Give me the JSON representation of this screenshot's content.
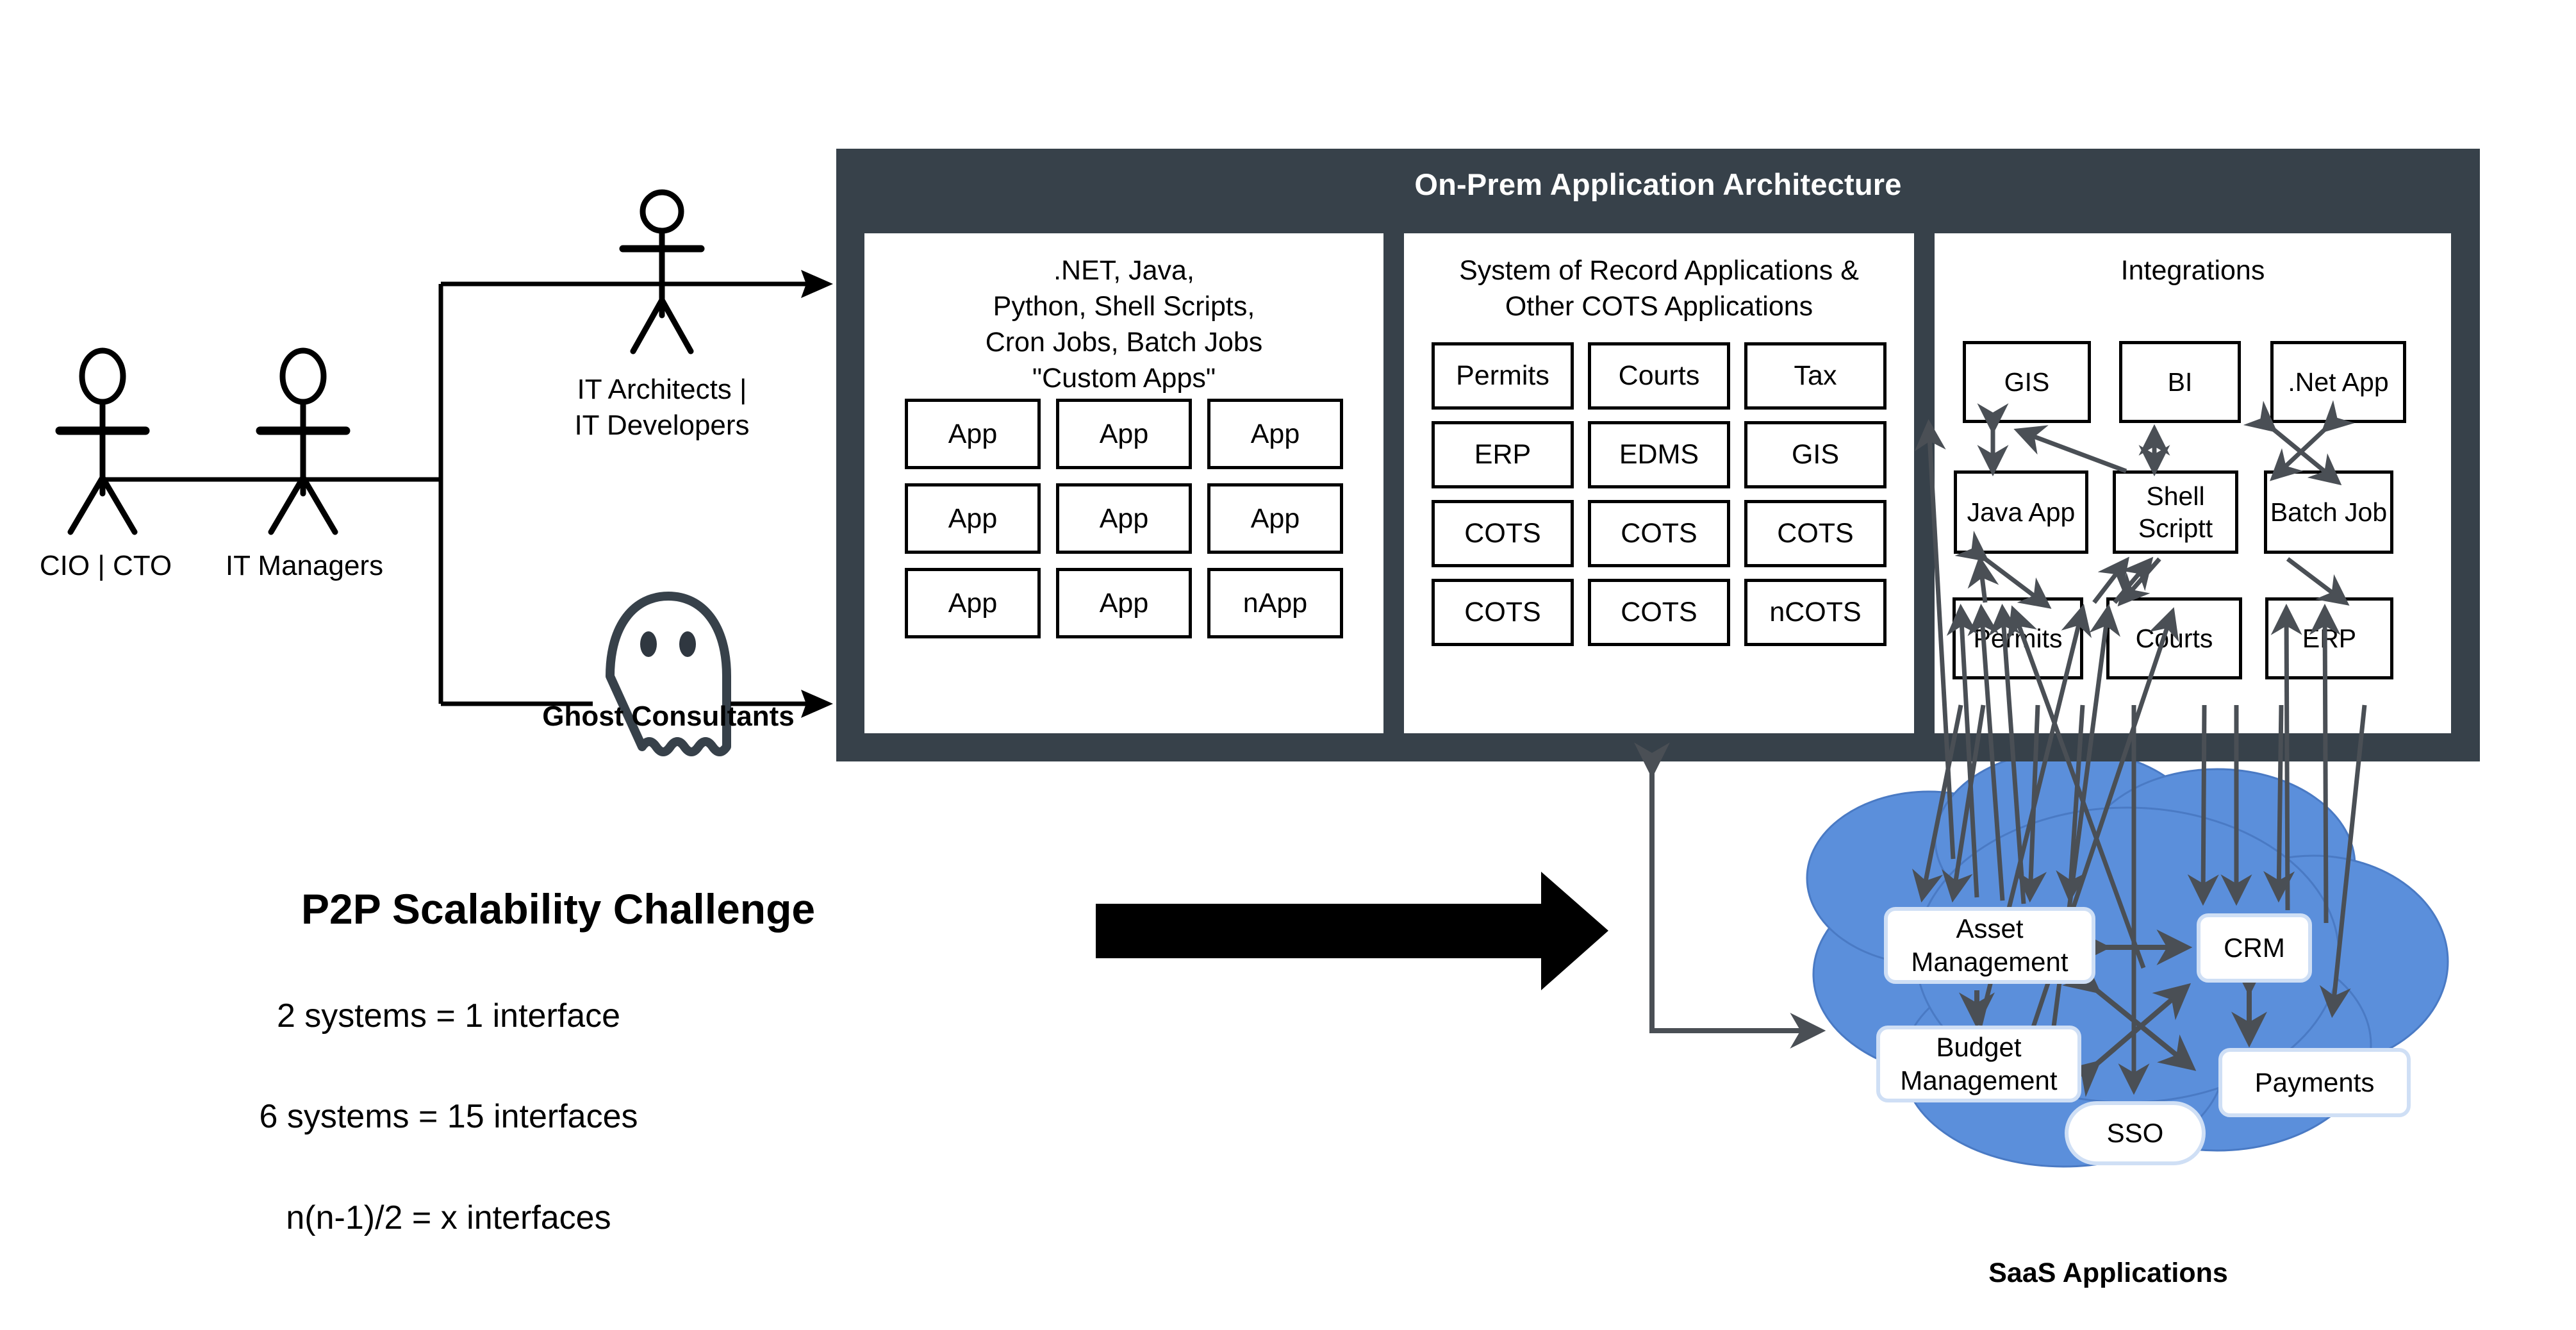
{
  "onprem": {
    "title": "On-Prem Application Architecture",
    "panels": [
      {
        "id": "custom-apps",
        "heading": ".NET, Java,\nPython, Shell Scripts,\nCron Jobs, Batch Jobs\n\"Custom Apps\"",
        "cells": [
          "App",
          "App",
          "App",
          "App",
          "App",
          "App",
          "App",
          "App",
          "nApp"
        ]
      },
      {
        "id": "system-of-record",
        "heading": "System of Record Applications &\nOther COTS Applications",
        "cells": [
          "Permits",
          "Courts",
          "Tax",
          "ERP",
          "EDMS",
          "GIS",
          "COTS",
          "COTS",
          "COTS",
          "COTS",
          "COTS",
          "nCOTS"
        ]
      },
      {
        "id": "integrations",
        "heading": "Integrations",
        "cells": [
          "GIS",
          "BI",
          ".Net App",
          "Java App",
          "Shell\nScriptt",
          "Batch\nJob",
          "Permits",
          "Courts",
          "ERP"
        ]
      }
    ]
  },
  "people": [
    {
      "id": "cio-cto",
      "label": "CIO | CTO",
      "bold": false
    },
    {
      "id": "it-managers",
      "label": "IT Managers",
      "bold": false
    },
    {
      "id": "it-architects",
      "label": "IT Architects |\nIT Developers",
      "bold": false
    },
    {
      "id": "ghost-consultants",
      "label": "Ghost Consultants",
      "bold": true
    }
  ],
  "saas": {
    "label": "SaaS Applications",
    "nodes": [
      {
        "id": "asset-management",
        "label": "Asset\nManagement"
      },
      {
        "id": "crm",
        "label": "CRM"
      },
      {
        "id": "budget-management",
        "label": "Budget\nManagement"
      },
      {
        "id": "payments",
        "label": "Payments"
      },
      {
        "id": "sso",
        "label": "SSO"
      }
    ]
  },
  "p2p": {
    "title": "P2P Scalability Challenge",
    "lines": [
      "2 systems = 1 interface",
      "6 systems = 15 interfaces",
      "n(n-1)/2 = x interfaces"
    ]
  },
  "colors": {
    "panel_dark": "#37414a",
    "cloud_blue": "#5b8fdb",
    "arrow_gray": "#4a4f55",
    "stroke_black": "#000000",
    "white": "#ffffff"
  }
}
